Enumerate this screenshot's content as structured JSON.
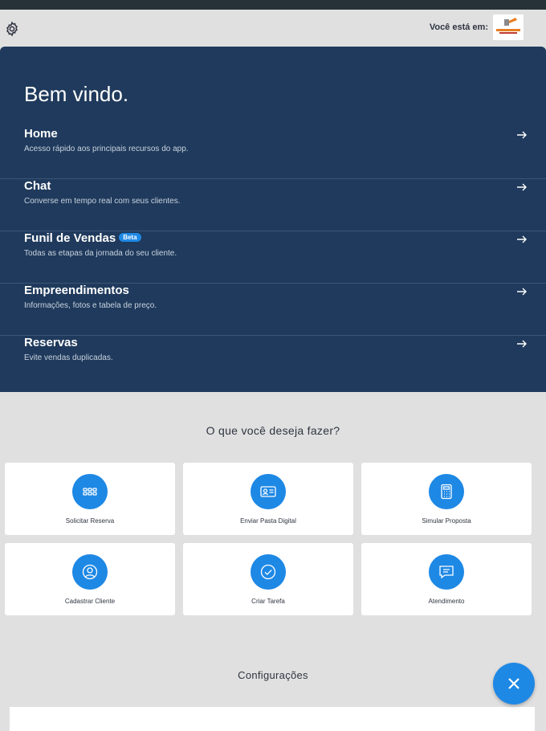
{
  "header": {
    "location_label": "Você está em:"
  },
  "welcome": {
    "title": "Bem vindo."
  },
  "menu": [
    {
      "title": "Home",
      "subtitle": "Acesso rápido aos principais recursos do app."
    },
    {
      "title": "Chat",
      "subtitle": "Converse em tempo real com seus clientes."
    },
    {
      "title": "Funil de Vendas",
      "badge": "Beta",
      "subtitle": "Todas as etapas da jornada do seu cliente."
    },
    {
      "title": "Empreendimentos",
      "subtitle": "Informações, fotos e tabela de preço."
    },
    {
      "title": "Reservas",
      "subtitle": "Evite vendas duplicadas."
    }
  ],
  "actions": {
    "title": "O que você deseja fazer?",
    "items": [
      {
        "label": "Solicitar Reserva",
        "icon": "grid-icon"
      },
      {
        "label": "Enviar Pasta Digital",
        "icon": "id-card-icon"
      },
      {
        "label": "Simular Proposta",
        "icon": "calculator-icon"
      },
      {
        "label": "Cadastrar Cliente",
        "icon": "user-icon"
      },
      {
        "label": "Criar Tarefa",
        "icon": "check-icon"
      },
      {
        "label": "Atendimento",
        "icon": "chat-icon"
      }
    ]
  },
  "settings": {
    "title": "Configurações"
  },
  "colors": {
    "navy": "#1f3a5c",
    "accent": "#1e88e5",
    "background": "#e0e0e0"
  }
}
